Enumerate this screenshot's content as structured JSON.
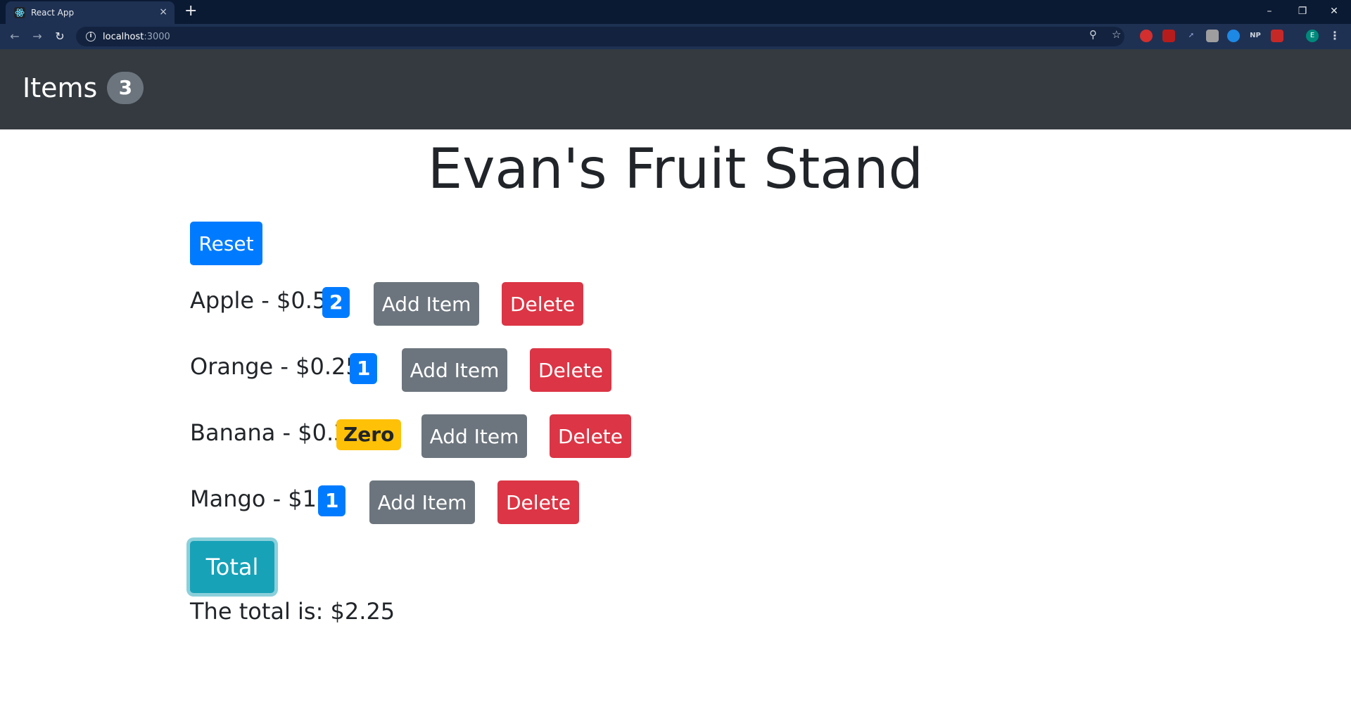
{
  "browser": {
    "tab_title": "React App",
    "tab_close": "×",
    "new_tab": "+",
    "url_host": "localhost",
    "url_port": ":3000",
    "window_controls": {
      "minimize": "–",
      "restore": "❐",
      "close": "✕"
    },
    "extensions": [
      "NP"
    ],
    "profile_initial": "E"
  },
  "navbar": {
    "brand": "Items",
    "count": "3"
  },
  "page": {
    "title": "Evan's Fruit Stand",
    "reset_label": "Reset",
    "add_label": "Add Item",
    "delete_label": "Delete",
    "items": [
      {
        "label": "Apple - $0.5",
        "badge": "2"
      },
      {
        "label": "Orange - $0.25",
        "badge": "1"
      },
      {
        "label": "Banana - $0.3",
        "badge": "Zero"
      },
      {
        "label": "Mango - $1",
        "badge": "1"
      }
    ],
    "total_label": "Total",
    "total_text": "The total is: $2.25"
  },
  "colors": {
    "primary": "#007bff",
    "secondary": "#6c757d",
    "danger": "#dc3545",
    "warning": "#ffc107",
    "info": "#17a2b8",
    "navbar": "#343a40"
  }
}
